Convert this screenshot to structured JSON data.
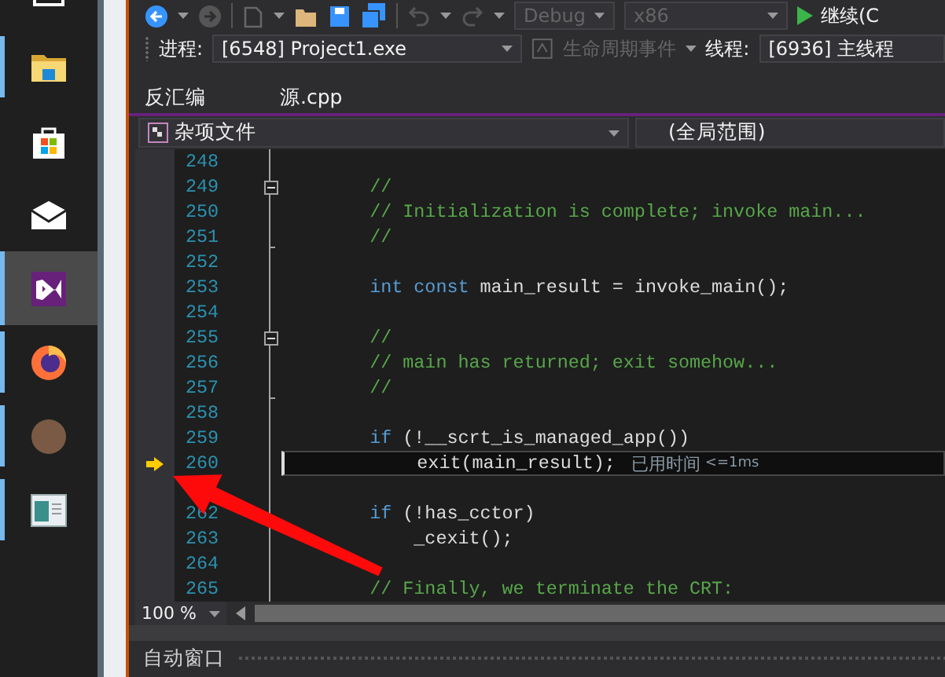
{
  "taskbar": {
    "items": [
      {
        "kind": "window",
        "running": false,
        "selected": false
      },
      {
        "kind": "folder",
        "running": true,
        "selected": false
      },
      {
        "kind": "store",
        "running": false,
        "selected": false
      },
      {
        "kind": "mail",
        "running": false,
        "selected": false
      },
      {
        "kind": "studio",
        "running": true,
        "selected": true
      },
      {
        "kind": "browser",
        "running": true,
        "selected": false
      },
      {
        "kind": "avatar",
        "running": true,
        "selected": false
      },
      {
        "kind": "viewer",
        "running": true,
        "selected": false
      }
    ]
  },
  "toolbar": {
    "configuration": "Debug",
    "platform": "x86",
    "continue_label": "继续(C"
  },
  "debug_location": {
    "process_label": "进程:",
    "process": "[6548] Project1.exe",
    "lifecycle": "生命周期事件",
    "lifecycle_disabled": true,
    "thread_label": "线程:",
    "thread": "[6936] 主线程"
  },
  "tabs": [
    {
      "label": "反汇编",
      "selected": false
    },
    {
      "label": "源.cpp",
      "selected": false
    }
  ],
  "navigation": {
    "project": "杂项文件",
    "scope": "(全局范围)"
  },
  "editor": {
    "lines": [
      {
        "number": "248",
        "current": false,
        "fold_start": false,
        "fold_end": false
      },
      {
        "number": "249",
        "current": false,
        "fold_start": true,
        "fold_end": false,
        "tokens": [
          {
            "kind": "comment",
            "text": "        //"
          }
        ]
      },
      {
        "number": "250",
        "current": false,
        "fold_start": false,
        "fold_end": false,
        "tokens": [
          {
            "kind": "comment",
            "text": "        // Initialization is complete; invoke main..."
          }
        ]
      },
      {
        "number": "251",
        "current": false,
        "fold_start": false,
        "fold_end": true,
        "tokens": [
          {
            "kind": "comment",
            "text": "        //"
          }
        ]
      },
      {
        "number": "252",
        "current": false,
        "fold_start": false,
        "fold_end": false
      },
      {
        "number": "253",
        "current": false,
        "fold_start": false,
        "fold_end": false,
        "tokens": [
          {
            "kind": "keyword",
            "text": "        int"
          },
          {
            "kind": "keyword",
            "text": " const"
          },
          {
            "kind": "plain",
            "text": " main_result = invoke_main();"
          }
        ]
      },
      {
        "number": "254",
        "current": false,
        "fold_start": false,
        "fold_end": false
      },
      {
        "number": "255",
        "current": false,
        "fold_start": true,
        "fold_end": false,
        "tokens": [
          {
            "kind": "comment",
            "text": "        //"
          }
        ]
      },
      {
        "number": "256",
        "current": false,
        "fold_start": false,
        "fold_end": false,
        "tokens": [
          {
            "kind": "comment",
            "text": "        // main has returned; exit somehow..."
          }
        ]
      },
      {
        "number": "257",
        "current": false,
        "fold_start": false,
        "fold_end": true,
        "tokens": [
          {
            "kind": "comment",
            "text": "        //"
          }
        ]
      },
      {
        "number": "258",
        "current": false,
        "fold_start": false,
        "fold_end": false
      },
      {
        "number": "259",
        "current": false,
        "fold_start": false,
        "fold_end": false,
        "tokens": [
          {
            "kind": "keyword",
            "text": "        if"
          },
          {
            "kind": "plain",
            "text": " (!__scrt_is_managed_app())"
          }
        ]
      },
      {
        "number": "260",
        "current": true,
        "fold_start": false,
        "fold_end": false,
        "tokens": [
          {
            "kind": "plain",
            "text": "            exit(main_result);"
          }
        ],
        "hint": {
          "label": "已用时间",
          "value": "<=1ms"
        }
      },
      {
        "current": false,
        "fold_start": false,
        "fold_end": false
      },
      {
        "number": "262",
        "current": false,
        "fold_start": false,
        "fold_end": false,
        "tokens": [
          {
            "kind": "keyword",
            "text": "        if"
          },
          {
            "kind": "plain",
            "text": " (!has_cctor)"
          }
        ]
      },
      {
        "number": "263",
        "current": false,
        "fold_start": false,
        "fold_end": false,
        "tokens": [
          {
            "kind": "plain",
            "text": "            _cexit();"
          }
        ]
      },
      {
        "number": "264",
        "current": false,
        "fold_start": false,
        "fold_end": false
      },
      {
        "number": "265",
        "current": false,
        "fold_start": false,
        "fold_end": false,
        "tokens": [
          {
            "kind": "comment",
            "text": "        // Finally, we terminate the CRT:"
          }
        ]
      }
    ]
  },
  "zoom": "100 %",
  "bottom_panel": {
    "title": "自动窗口"
  }
}
